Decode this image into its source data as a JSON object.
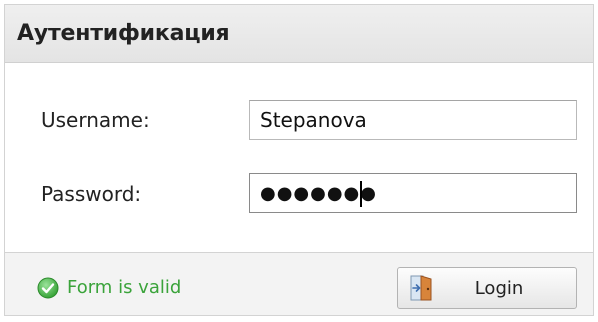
{
  "dialog": {
    "title": "Аутентификация"
  },
  "form": {
    "username_label": "Username:",
    "username_value": "Stepanova",
    "password_label": "Password:",
    "password_masked": "●●●●●●●"
  },
  "footer": {
    "status_text": "Form is valid",
    "status_icon": "check-circle-icon",
    "login_label": "Login",
    "login_icon": "door-exit-icon"
  },
  "colors": {
    "valid_green": "#3aa33a"
  }
}
